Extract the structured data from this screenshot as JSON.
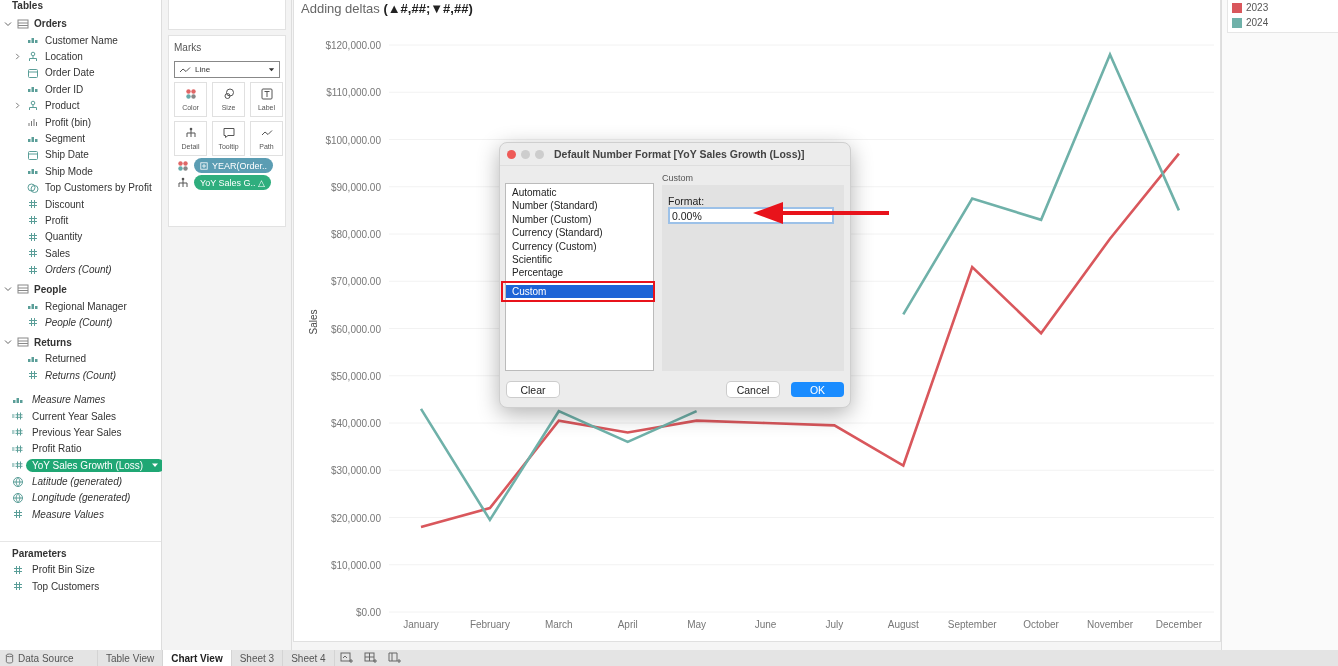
{
  "data_pane": {
    "title": "Tables",
    "groups": [
      {
        "name": "Orders",
        "expanded": true,
        "children": [
          {
            "label": "Customer Name",
            "kind": "abc",
            "italic": false,
            "expandable": false
          },
          {
            "label": "Location",
            "kind": "geo",
            "italic": false,
            "expandable": true
          },
          {
            "label": "Order Date",
            "kind": "date",
            "italic": false,
            "expandable": false
          },
          {
            "label": "Order ID",
            "kind": "abc",
            "italic": false,
            "expandable": false
          },
          {
            "label": "Product",
            "kind": "geo",
            "italic": false,
            "expandable": true
          },
          {
            "label": "Profit (bin)",
            "kind": "bin",
            "italic": false,
            "expandable": false
          },
          {
            "label": "Segment",
            "kind": "abc",
            "italic": false,
            "expandable": false
          },
          {
            "label": "Ship Date",
            "kind": "date",
            "italic": false,
            "expandable": false
          },
          {
            "label": "Ship Mode",
            "kind": "abc",
            "italic": false,
            "expandable": false
          },
          {
            "label": "Top Customers by Profit",
            "kind": "set",
            "italic": false,
            "expandable": false
          },
          {
            "label": "Discount",
            "kind": "measure",
            "italic": false,
            "expandable": false
          },
          {
            "label": "Profit",
            "kind": "measure",
            "italic": false,
            "expandable": false
          },
          {
            "label": "Quantity",
            "kind": "measure",
            "italic": false,
            "expandable": false
          },
          {
            "label": "Sales",
            "kind": "measure",
            "italic": false,
            "expandable": false
          },
          {
            "label": "Orders (Count)",
            "kind": "measure",
            "italic": true,
            "expandable": false
          }
        ]
      },
      {
        "name": "People",
        "expanded": true,
        "children": [
          {
            "label": "Regional Manager",
            "kind": "abc",
            "italic": false,
            "expandable": false
          },
          {
            "label": "People (Count)",
            "kind": "measure",
            "italic": true,
            "expandable": false
          }
        ]
      },
      {
        "name": "Returns",
        "expanded": true,
        "children": [
          {
            "label": "Returned",
            "kind": "abc",
            "italic": false,
            "expandable": false
          },
          {
            "label": "Returns (Count)",
            "kind": "measure",
            "italic": true,
            "expandable": false
          }
        ]
      }
    ],
    "fields": [
      {
        "label": "Measure Names",
        "kind": "abc",
        "italic": true,
        "selected": false
      },
      {
        "label": "Current Year Sales",
        "kind": "calc",
        "italic": false,
        "selected": false
      },
      {
        "label": "Previous Year Sales",
        "kind": "calc",
        "italic": false,
        "selected": false
      },
      {
        "label": "Profit Ratio",
        "kind": "calc",
        "italic": false,
        "selected": false
      },
      {
        "label": "YoY Sales Growth (Loss)",
        "kind": "calc",
        "italic": false,
        "selected": true
      },
      {
        "label": "Latitude (generated)",
        "kind": "globe",
        "italic": true,
        "selected": false
      },
      {
        "label": "Longitude (generated)",
        "kind": "globe",
        "italic": true,
        "selected": false
      },
      {
        "label": "Measure Values",
        "kind": "measure",
        "italic": true,
        "selected": false
      }
    ],
    "parameters": {
      "title": "Parameters",
      "items": [
        {
          "label": "Profit Bin Size",
          "kind": "measure"
        },
        {
          "label": "Top Customers",
          "kind": "measure"
        }
      ]
    }
  },
  "marks": {
    "title": "Marks",
    "mark_type": "Line",
    "cards": [
      {
        "label": "Color",
        "kind": "color"
      },
      {
        "label": "Size",
        "kind": "size"
      },
      {
        "label": "Label",
        "kind": "label"
      },
      {
        "label": "Detail",
        "kind": "detail"
      },
      {
        "label": "Tooltip",
        "kind": "tooltip"
      },
      {
        "label": "Path",
        "kind": "path"
      }
    ],
    "pills": [
      {
        "kind": "color",
        "label": "YEAR(Order..",
        "color": "#5b9db3"
      },
      {
        "kind": "detail",
        "label": "YoY Sales G..  △",
        "color": "#2fae7e"
      }
    ]
  },
  "view": {
    "title": "Adding deltas **(▲#,##;▼#,##)**",
    "chart_data": {
      "type": "line",
      "ylabel": "Sales",
      "categories": [
        "January",
        "February",
        "March",
        "April",
        "May",
        "June",
        "July",
        "August",
        "September",
        "October",
        "November",
        "December"
      ],
      "series": [
        {
          "name": "2023",
          "color": "#d9575c",
          "values": [
            18000,
            22000,
            40500,
            38000,
            40500,
            40000,
            39500,
            31000,
            73000,
            59000,
            79000,
            97000
          ]
        },
        {
          "name": "2024",
          "color": "#6fb1a9",
          "values": [
            43000,
            19500,
            42500,
            36000,
            42500,
            null,
            null,
            63000,
            87500,
            83000,
            118000,
            85000
          ]
        }
      ],
      "ylim": [
        0,
        120000
      ],
      "grid": true,
      "yticks": [
        {
          "value": 0,
          "label": "$0.00"
        },
        {
          "value": 10000,
          "label": "$10,000.00"
        },
        {
          "value": 20000,
          "label": "$20,000.00"
        },
        {
          "value": 30000,
          "label": "$30,000.00"
        },
        {
          "value": 40000,
          "label": "$40,000.00"
        },
        {
          "value": 50000,
          "label": "$50,000.00"
        },
        {
          "value": 60000,
          "label": "$60,000.00"
        },
        {
          "value": 70000,
          "label": "$70,000.00"
        },
        {
          "value": 80000,
          "label": "$80,000.00"
        },
        {
          "value": 90000,
          "label": "$90,000.00"
        },
        {
          "value": 100000,
          "label": "$100,000.00"
        },
        {
          "value": 110000,
          "label": "$110,000.00"
        },
        {
          "value": 120000,
          "label": "$120,000.00"
        }
      ]
    }
  },
  "dialog": {
    "title": "Default Number Format [YoY Sales Growth (Loss)]",
    "formats": [
      {
        "label": "Automatic",
        "selected": false
      },
      {
        "label": "Number (Standard)",
        "selected": false
      },
      {
        "label": "Number (Custom)",
        "selected": false
      },
      {
        "label": "Currency (Standard)",
        "selected": false
      },
      {
        "label": "Currency (Custom)",
        "selected": false
      },
      {
        "label": "Scientific",
        "selected": false
      },
      {
        "label": "Percentage",
        "selected": false
      },
      {
        "label": "Custom",
        "selected": true
      }
    ],
    "section": "Custom",
    "format_label": "Format:",
    "format_value": "0.00%",
    "buttons": [
      {
        "label": "Clear",
        "kind": "secondary"
      },
      {
        "label": "Cancel",
        "kind": "secondary"
      },
      {
        "label": "OK",
        "kind": "primary"
      }
    ]
  },
  "sheet_tabs": [
    {
      "label": "Data Source",
      "kind": "source",
      "selected": false
    },
    {
      "label": "Table View",
      "kind": "sheet",
      "selected": false
    },
    {
      "label": "Chart View",
      "kind": "sheet",
      "selected": true
    },
    {
      "label": "Sheet 3",
      "kind": "sheet",
      "selected": false
    },
    {
      "label": "Sheet 4",
      "kind": "sheet",
      "selected": false
    }
  ]
}
